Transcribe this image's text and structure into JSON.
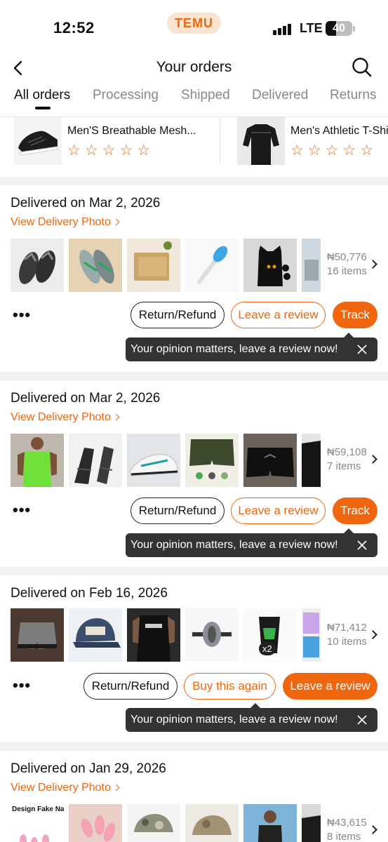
{
  "status_bar": {
    "time": "12:52",
    "app_badge": "TEMU",
    "network": "LTE",
    "battery_level": "40",
    "battery_fraction": 0.4
  },
  "header": {
    "title": "Your orders",
    "back_icon": "chevron-left-icon",
    "search_icon": "search-icon"
  },
  "tabs": [
    "All orders",
    "Processing",
    "Shipped",
    "Delivered",
    "Returns"
  ],
  "active_tab": "All orders",
  "review_carousel": [
    {
      "name": "Men'S Breathable Mesh...",
      "stars": "☆☆☆☆☆"
    },
    {
      "name": "Men's Athletic T-Shirt",
      "stars": "☆☆☆☆☆"
    }
  ],
  "orders": [
    {
      "title": "Delivered on Mar 2, 2026",
      "photo_link": "View Delivery Photo",
      "price": "₦50,776",
      "items": "16 items",
      "more": "•••",
      "buttons": [
        "Return/Refund",
        "Leave a review",
        "Track"
      ],
      "tooltip": "Your opinion matters, leave a review now!"
    },
    {
      "title": "Delivered on Mar 2, 2026",
      "photo_link": "View Delivery Photo",
      "price": "₦59,108",
      "items": "7 items",
      "more": "•••",
      "buttons": [
        "Return/Refund",
        "Leave a review",
        "Track"
      ],
      "tooltip": "Your opinion matters, leave a review now!"
    },
    {
      "title": "Delivered on Feb 16, 2026",
      "photo_link": "",
      "price": "₦71,412",
      "items": "10 items",
      "more": "•••",
      "qty_badge": "x2",
      "buttons": [
        "Return/Refund",
        "Buy this again",
        "Leave a review"
      ],
      "tooltip": "Your opinion matters, leave a review now!"
    },
    {
      "title": "Delivered on Jan 29, 2026",
      "photo_link": "View Delivery Photo",
      "price": "₦43,615",
      "items": "8 items",
      "thumb_caption": "Design Fake Nails"
    }
  ],
  "colors": {
    "accent": "#f0660e",
    "badge_bg": "#fbe3d1",
    "tooltip_bg": "#333333",
    "muted": "#888888"
  }
}
